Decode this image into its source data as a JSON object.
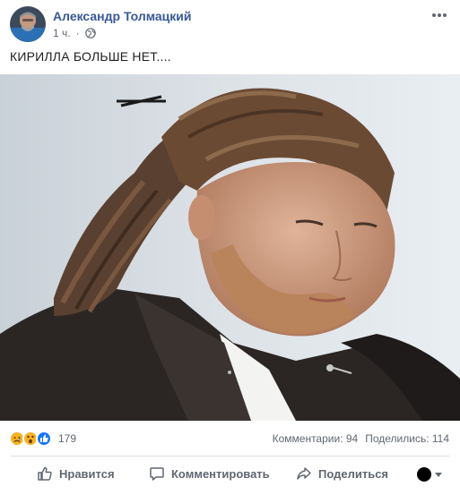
{
  "post": {
    "author": "Александр Толмацкий",
    "timestamp": "1 ч.",
    "privacy_icon": "globe-icon",
    "text": "КИРИЛЛА БОЛЬШЕ НЕТ....",
    "more_icon": "more-horizontal-icon"
  },
  "reactions": {
    "icons": [
      "sad-reaction-icon",
      "wow-reaction-icon",
      "like-reaction-icon"
    ],
    "count": "179",
    "comments": "Комментарии: 94",
    "shares": "Поделились: 114"
  },
  "actions": {
    "like": "Нравится",
    "comment": "Комментировать",
    "share": "Поделиться"
  },
  "colors": {
    "author_link": "#385898",
    "secondary_text": "#606770",
    "like_blue": "#1877f2",
    "reaction_yellow": "#f7b125"
  }
}
